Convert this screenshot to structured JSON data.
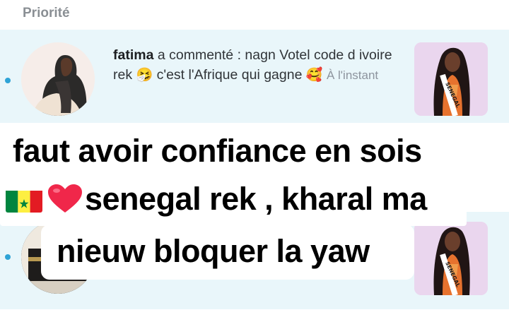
{
  "section": {
    "title": "Priorité"
  },
  "notifications": [
    {
      "user": "fatima",
      "action": " a commenté : nagn Votel code d ivoire rek",
      "emoji1": "🤧",
      "text2": " c'est l'Afrique qui gagne",
      "emoji2": "🥰",
      "timestamp": "À l'instant",
      "thumbnail_caption": "SENEGAL"
    },
    {
      "thumbnail_caption": "SENEGAL"
    }
  ],
  "overlay": {
    "line1": "faut avoir confiance en sois",
    "line2": "senegal rek , kharal ma",
    "line3": "nieuw bloquer la yaw"
  },
  "colors": {
    "row_background": "#e9f6fa",
    "unread_dot": "#2ea3d6",
    "flag": [
      "#00853f",
      "#fdef42",
      "#e31b23"
    ],
    "heart": "#f0274a"
  }
}
